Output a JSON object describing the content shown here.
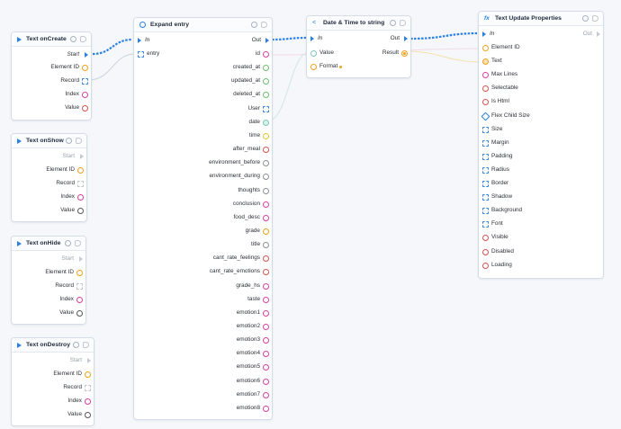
{
  "colors": {
    "accent": "#2b7fe0",
    "orange": "#f0a01e",
    "pink": "#d6409f",
    "red": "#d9534f",
    "green": "#6cc070",
    "yellow": "#e8c23a",
    "gray": "#8a8f98",
    "blue": "#2b7fe0",
    "teal": "#7bc7b6",
    "purple": "#7b5ea7"
  },
  "nodes": {
    "on_create": {
      "title": "Text onCreate",
      "start": "Start",
      "outputs": [
        "Element ID",
        "Record",
        "Index",
        "Value"
      ]
    },
    "on_show": {
      "title": "Text onShow",
      "start": "Start",
      "outputs": [
        "Element ID",
        "Record",
        "Index",
        "Value"
      ]
    },
    "on_hide": {
      "title": "Text onHide",
      "start": "Start",
      "outputs": [
        "Element ID",
        "Record",
        "Index",
        "Value"
      ]
    },
    "on_destroy": {
      "title": "Text onDestroy",
      "start": "Start",
      "outputs": [
        "Element ID",
        "Record",
        "Index",
        "Value"
      ]
    },
    "expand_entry": {
      "title": "Expand entry",
      "in": "In",
      "out": "Out",
      "input": "entry",
      "outputs": [
        "id",
        "created_at",
        "updated_at",
        "deleted_at",
        "User",
        "date",
        "time",
        "after_meal",
        "environment_before",
        "environment_during",
        "thoughts",
        "conclusion",
        "food_desc",
        "grade",
        "title",
        "cant_rate_feelings",
        "cant_rate_emotions",
        "grade_hs",
        "taste",
        "emotion1",
        "emotion2",
        "emotion3",
        "emotion4",
        "emotion5",
        "emotion6",
        "emotion7",
        "emotion8"
      ]
    },
    "date_time": {
      "title": "Date & Time to string",
      "in": "In",
      "out": "Out",
      "inputs": [
        "Value",
        "Format"
      ],
      "result": "Result"
    },
    "text_update": {
      "title": "Text Update Properties",
      "in": "In",
      "out": "Out",
      "inputs": [
        "Element ID",
        "Text",
        "Max Lines",
        "Selectable",
        "Is Html",
        "Flex Child Size",
        "Size",
        "Margin",
        "Padding",
        "Radius",
        "Border",
        "Shadow",
        "Background",
        "Font",
        "Visible",
        "Disabled",
        "Loading"
      ]
    }
  }
}
